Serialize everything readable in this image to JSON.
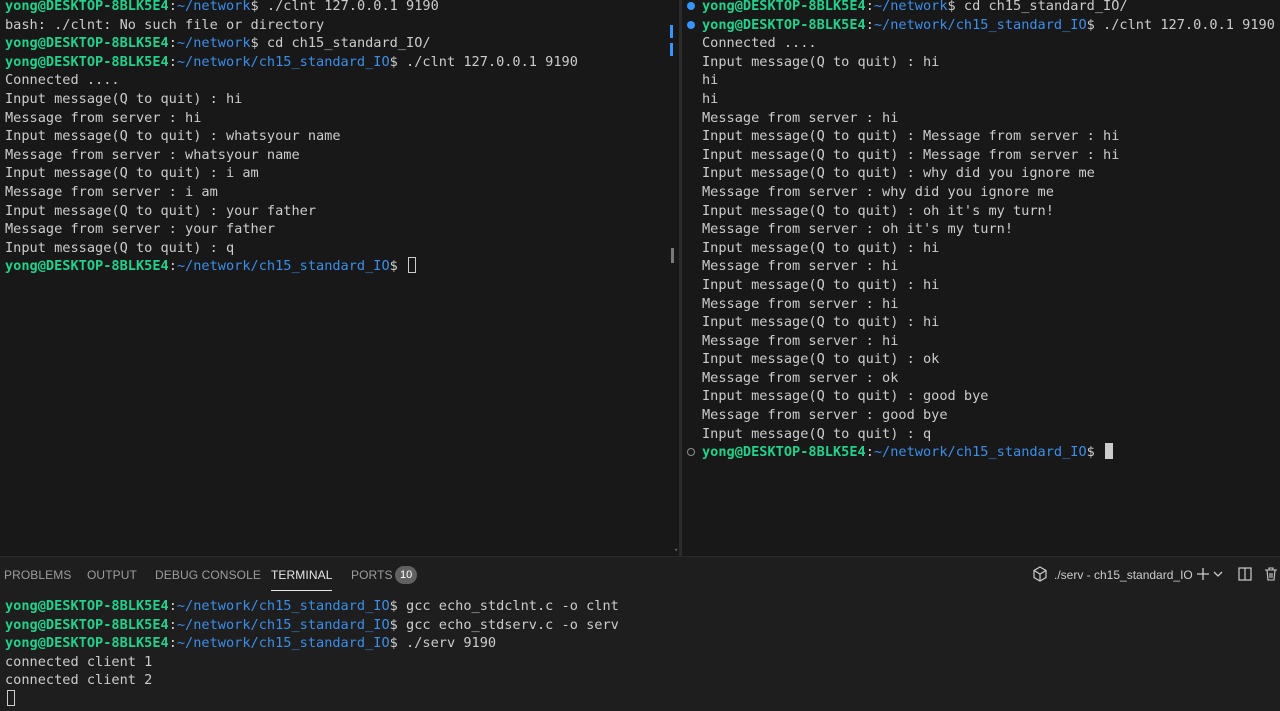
{
  "left_pane": {
    "lines": [
      [
        {
          "t": "yong@DESKTOP-8BLK5E4",
          "c": "user"
        },
        {
          "t": ":",
          "c": "txt"
        },
        {
          "t": "~/network",
          "c": "path"
        },
        {
          "t": "$ ./clnt 127.0.0.1 9190",
          "c": "txt"
        }
      ],
      [
        {
          "t": "bash: ./clnt: No such file or directory",
          "c": "txt"
        }
      ],
      [
        {
          "t": "yong@DESKTOP-8BLK5E4",
          "c": "user"
        },
        {
          "t": ":",
          "c": "txt"
        },
        {
          "t": "~/network",
          "c": "path"
        },
        {
          "t": "$ cd ch15_standard_IO/",
          "c": "txt"
        }
      ],
      [
        {
          "t": "yong@DESKTOP-8BLK5E4",
          "c": "user"
        },
        {
          "t": ":",
          "c": "txt"
        },
        {
          "t": "~/network/ch15_standard_IO",
          "c": "path"
        },
        {
          "t": "$ ./clnt 127.0.0.1 9190",
          "c": "txt"
        }
      ],
      [
        {
          "t": "Connected ....",
          "c": "txt"
        }
      ],
      [
        {
          "t": "Input message(Q to quit) : hi",
          "c": "txt"
        }
      ],
      [
        {
          "t": "Message from server : hi",
          "c": "txt"
        }
      ],
      [
        {
          "t": "Input message(Q to quit) : whatsyour name",
          "c": "txt"
        }
      ],
      [
        {
          "t": "Message from server : whatsyour name",
          "c": "txt"
        }
      ],
      [
        {
          "t": "Input message(Q to quit) : i am",
          "c": "txt"
        }
      ],
      [
        {
          "t": "Message from server : i am",
          "c": "txt"
        }
      ],
      [
        {
          "t": "Input message(Q to quit) : your father",
          "c": "txt"
        }
      ],
      [
        {
          "t": "Message from server : your father",
          "c": "txt"
        }
      ],
      [
        {
          "t": "Input message(Q to quit) : q",
          "c": "txt"
        }
      ],
      [
        {
          "t": "yong@DESKTOP-8BLK5E4",
          "c": "user"
        },
        {
          "t": ":",
          "c": "txt"
        },
        {
          "t": "~/network/ch15_standard_IO",
          "c": "path"
        },
        {
          "t": "$ ",
          "c": "txt"
        },
        {
          "t": "",
          "c": "cursor-hollow"
        }
      ]
    ]
  },
  "right_pane": {
    "lines": [
      [
        {
          "t": "",
          "c": "deco-success"
        },
        {
          "t": "yong@DESKTOP-8BLK5E4",
          "c": "user"
        },
        {
          "t": ":",
          "c": "txt"
        },
        {
          "t": "~/network",
          "c": "path"
        },
        {
          "t": "$ cd ch15_standard_IO/",
          "c": "txt"
        }
      ],
      [
        {
          "t": "",
          "c": "deco-success"
        },
        {
          "t": "yong@DESKTOP-8BLK5E4",
          "c": "user"
        },
        {
          "t": ":",
          "c": "txt"
        },
        {
          "t": "~/network/ch15_standard_IO",
          "c": "path"
        },
        {
          "t": "$ ./clnt 127.0.0.1 9190",
          "c": "txt"
        }
      ],
      [
        {
          "t": "Connected ....",
          "c": "txt"
        }
      ],
      [
        {
          "t": "Input message(Q to quit) : hi",
          "c": "txt"
        }
      ],
      [
        {
          "t": "hi",
          "c": "txt"
        }
      ],
      [
        {
          "t": "hi",
          "c": "txt"
        }
      ],
      [
        {
          "t": "Message from server : hi",
          "c": "txt"
        }
      ],
      [
        {
          "t": "Input message(Q to quit) : Message from server : hi",
          "c": "txt"
        }
      ],
      [
        {
          "t": "Input message(Q to quit) : Message from server : hi",
          "c": "txt"
        }
      ],
      [
        {
          "t": "Input message(Q to quit) : why did you ignore me",
          "c": "txt"
        }
      ],
      [
        {
          "t": "Message from server : why did you ignore me",
          "c": "txt"
        }
      ],
      [
        {
          "t": "Input message(Q to quit) : oh it's my turn!",
          "c": "txt"
        }
      ],
      [
        {
          "t": "Message from server : oh it's my turn!",
          "c": "txt"
        }
      ],
      [
        {
          "t": "Input message(Q to quit) : hi",
          "c": "txt"
        }
      ],
      [
        {
          "t": "Message from server : hi",
          "c": "txt"
        }
      ],
      [
        {
          "t": "Input message(Q to quit) : hi",
          "c": "txt"
        }
      ],
      [
        {
          "t": "Message from server : hi",
          "c": "txt"
        }
      ],
      [
        {
          "t": "Input message(Q to quit) : hi",
          "c": "txt"
        }
      ],
      [
        {
          "t": "Message from server : hi",
          "c": "txt"
        }
      ],
      [
        {
          "t": "Input message(Q to quit) : ok",
          "c": "txt"
        }
      ],
      [
        {
          "t": "Message from server : ok",
          "c": "txt"
        }
      ],
      [
        {
          "t": "Input message(Q to quit) : good bye",
          "c": "txt"
        }
      ],
      [
        {
          "t": "Message from server : good bye",
          "c": "txt"
        }
      ],
      [
        {
          "t": "Input message(Q to quit) : q",
          "c": "txt"
        }
      ],
      [
        {
          "t": "",
          "c": "deco-default"
        },
        {
          "t": "yong@DESKTOP-8BLK5E4",
          "c": "user"
        },
        {
          "t": ":",
          "c": "txt"
        },
        {
          "t": "~/network/ch15_standard_IO",
          "c": "path"
        },
        {
          "t": "$ ",
          "c": "txt"
        },
        {
          "t": "",
          "c": "cursor-solid"
        }
      ]
    ]
  },
  "panel": {
    "tabs": {
      "problems": "PROBLEMS",
      "output": "OUTPUT",
      "debug_console": "DEBUG CONSOLE",
      "terminal": "TERMINAL",
      "ports": "PORTS",
      "ports_count": "10"
    },
    "terminal_name": "./serv - ch15_standard_IO",
    "icons": {
      "terminal": "terminal-icon",
      "new": "plus-icon",
      "dropdown": "chevron-down-icon",
      "split": "split-icon",
      "kill": "trash-icon"
    }
  },
  "bottom_terminal": {
    "lines": [
      [
        {
          "t": "yong@DESKTOP-8BLK5E4",
          "c": "user"
        },
        {
          "t": ":",
          "c": "txt"
        },
        {
          "t": "~/network/ch15_standard_IO",
          "c": "path"
        },
        {
          "t": "$ gcc echo_stdclnt.c -o clnt",
          "c": "txt"
        }
      ],
      [
        {
          "t": "yong@DESKTOP-8BLK5E4",
          "c": "user"
        },
        {
          "t": ":",
          "c": "txt"
        },
        {
          "t": "~/network/ch15_standard_IO",
          "c": "path"
        },
        {
          "t": "$ gcc echo_stdserv.c -o serv",
          "c": "txt"
        }
      ],
      [
        {
          "t": "yong@DESKTOP-8BLK5E4",
          "c": "user"
        },
        {
          "t": ":",
          "c": "txt"
        },
        {
          "t": "~/network/ch15_standard_IO",
          "c": "path"
        },
        {
          "t": "$ ./serv 9190",
          "c": "txt"
        }
      ],
      [
        {
          "t": "connected client 1",
          "c": "txt"
        }
      ],
      [
        {
          "t": "connected client 2",
          "c": "txt"
        }
      ],
      [
        {
          "t": "",
          "c": "cursor-hollow"
        }
      ]
    ]
  },
  "colors": {
    "background": "#1e1e1e",
    "terminal_bg": "#181818",
    "text": "#cccccc",
    "user": "#23d18b",
    "path": "#3b8eea",
    "accent": "#3794ff"
  }
}
